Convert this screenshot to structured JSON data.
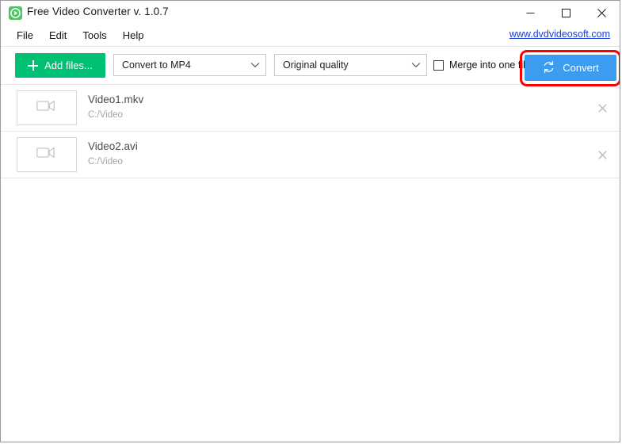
{
  "window": {
    "title": "Free Video Converter v. 1.0.7",
    "app_icon": "play-circle-icon",
    "accent_green": "#00c173",
    "accent_blue": "#3c9cef",
    "highlight_red": "#ff0000",
    "controls": {
      "minimize": "minimize-icon",
      "maximize": "maximize-icon",
      "close": "close-icon"
    }
  },
  "menubar": {
    "items": [
      {
        "label": "File"
      },
      {
        "label": "Edit"
      },
      {
        "label": "Tools"
      },
      {
        "label": "Help"
      }
    ],
    "site_link": "www.dvdvideosoft.com"
  },
  "toolbar": {
    "add_files_label": "Add files...",
    "add_files_icon": "plus-icon",
    "format_select": {
      "value": "Convert to MP4",
      "icon": "chevron-down-icon"
    },
    "quality_select": {
      "value": "Original quality",
      "icon": "chevron-down-icon"
    },
    "merge_checkbox": {
      "label": "Merge into one file",
      "checked": false
    },
    "convert_label": "Convert",
    "convert_icon": "refresh-icon"
  },
  "file_list": {
    "items": [
      {
        "name": "Video1.mkv",
        "path": "C:/Video",
        "thumb_icon": "video-camera-icon",
        "remove_icon": "close-icon"
      },
      {
        "name": "Video2.avi",
        "path": "C:/Video",
        "thumb_icon": "video-camera-icon",
        "remove_icon": "close-icon"
      }
    ]
  }
}
